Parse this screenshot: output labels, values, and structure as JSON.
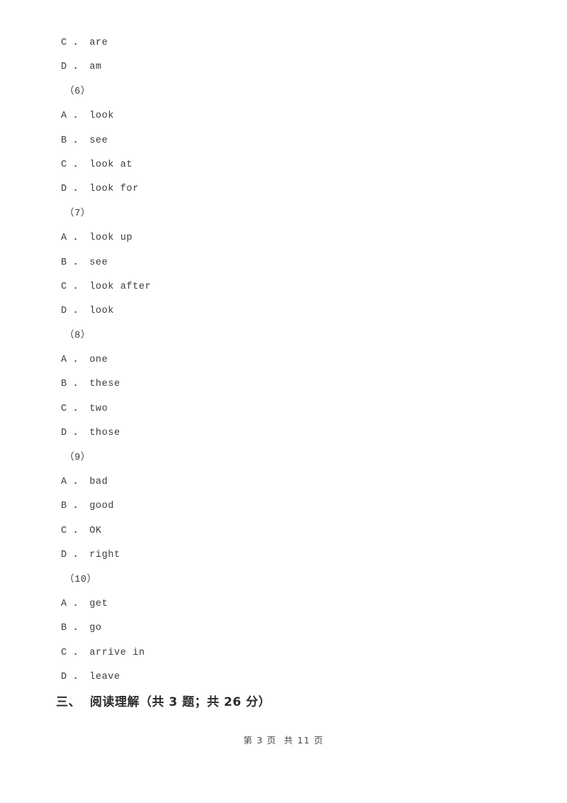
{
  "document": {
    "type": "exam-paper-page",
    "language": "zh-CN"
  },
  "body_lines": [
    {
      "kind": "option",
      "text": "C ． are"
    },
    {
      "kind": "option",
      "text": "D ． am"
    },
    {
      "kind": "qnum",
      "text": "（6）"
    },
    {
      "kind": "option",
      "text": "A ． look"
    },
    {
      "kind": "option",
      "text": "B ． see"
    },
    {
      "kind": "option",
      "text": "C ． look at"
    },
    {
      "kind": "option",
      "text": "D ． look for"
    },
    {
      "kind": "qnum",
      "text": "（7）"
    },
    {
      "kind": "option",
      "text": "A ． look up"
    },
    {
      "kind": "option",
      "text": "B ． see"
    },
    {
      "kind": "option",
      "text": "C ． look after"
    },
    {
      "kind": "option",
      "text": "D ． look"
    },
    {
      "kind": "qnum",
      "text": "（8）"
    },
    {
      "kind": "option",
      "text": "A ． one"
    },
    {
      "kind": "option",
      "text": "B ． these"
    },
    {
      "kind": "option",
      "text": "C ． two"
    },
    {
      "kind": "option",
      "text": "D ． those"
    },
    {
      "kind": "qnum",
      "text": "（9）"
    },
    {
      "kind": "option",
      "text": "A ． bad"
    },
    {
      "kind": "option",
      "text": "B ． good"
    },
    {
      "kind": "option",
      "text": "C ． OK"
    },
    {
      "kind": "option",
      "text": "D ． right"
    },
    {
      "kind": "qnum",
      "text": "（10）"
    },
    {
      "kind": "option",
      "text": "A ． get"
    },
    {
      "kind": "option",
      "text": "B ． go"
    },
    {
      "kind": "option",
      "text": "C ． arrive in"
    },
    {
      "kind": "option",
      "text": "D ． leave"
    }
  ],
  "section_heading": {
    "text": "三、  阅读理解（共 3 题；共 26 分）",
    "number": "三",
    "title": "阅读理解",
    "question_count": "3",
    "total_points": "26"
  },
  "footer": {
    "text": "第 3 页  共 11 页",
    "current_page": "3",
    "total_pages": "11"
  },
  "colors": {
    "text": "#3b3b3b",
    "heading": "#2b2b2b",
    "footer": "#4a4a4a",
    "background": "#ffffff"
  }
}
